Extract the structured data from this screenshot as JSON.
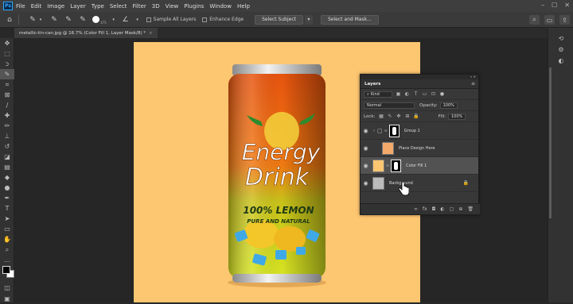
{
  "app": {
    "logo": "Ps",
    "menu": [
      "File",
      "Edit",
      "Image",
      "Layer",
      "Type",
      "Select",
      "Filter",
      "3D",
      "View",
      "Plugins",
      "Window",
      "Help"
    ],
    "window_controls": [
      "minimize-icon",
      "maximize-icon",
      "close-icon"
    ]
  },
  "options": {
    "brush_size": "375",
    "sample_all_layers": "Sample All Layers",
    "enhance_edge": "Enhance Edge",
    "select_subject": "Select Subject",
    "select_and_mask": "Select and Mask..."
  },
  "document": {
    "tab_title": "metallic-tin-can.jpg @ 16.7% (Color Fill 1, Layer Mask/8) *",
    "close": "×"
  },
  "artwork": {
    "brand_line1": "Energy",
    "brand_line2": "Drink",
    "flavor": "100% LEMON",
    "tagline": "PURE AND NATURAL",
    "background_color": "#fdc671"
  },
  "layers_panel": {
    "tab": "Layers",
    "filter_kind": "Kind",
    "blend_mode": "Normal",
    "opacity_label": "Opacity:",
    "opacity_value": "100%",
    "lock_label": "Lock:",
    "fill_label": "Fill:",
    "fill_value": "100%",
    "layers": [
      {
        "name": "Group 1"
      },
      {
        "name": "Place Design Here"
      },
      {
        "name": "Color Fill 1"
      },
      {
        "name": "Background"
      }
    ]
  }
}
